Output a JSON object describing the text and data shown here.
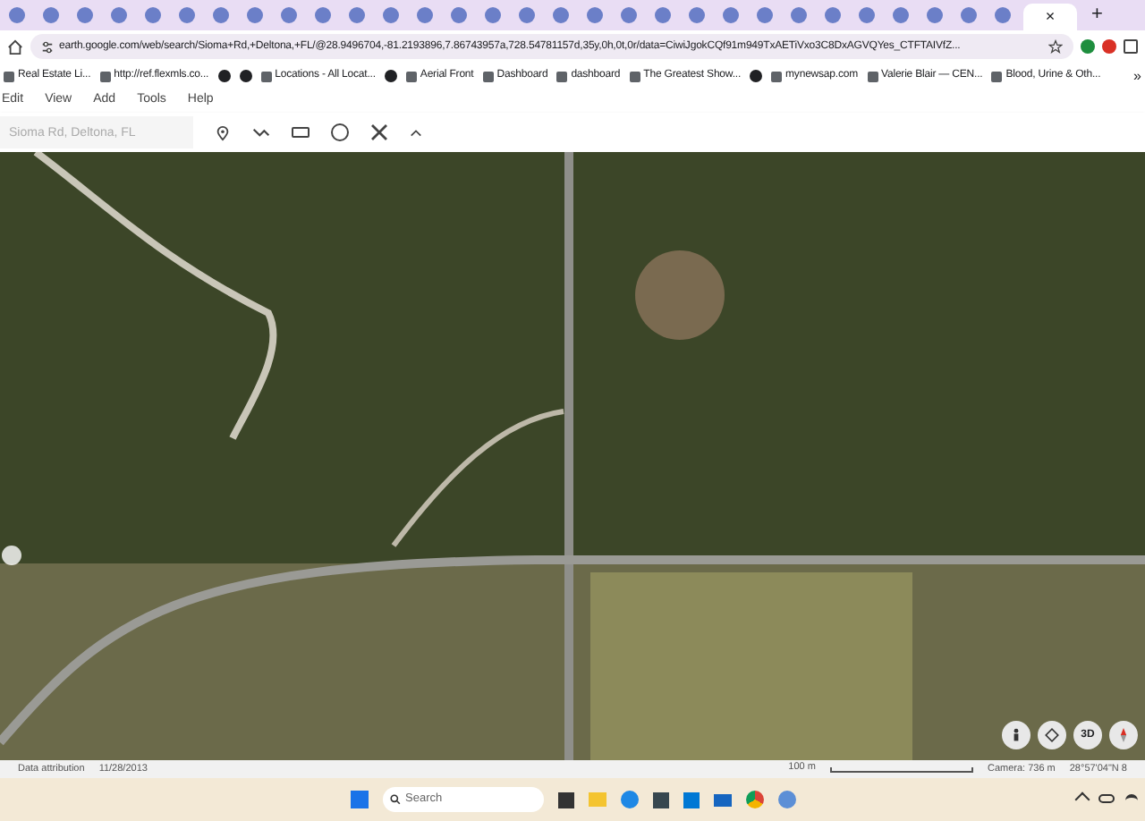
{
  "tabs": [
    {
      "selected": false
    },
    {
      "selected": false
    },
    {
      "selected": false
    },
    {
      "selected": false
    },
    {
      "selected": false
    },
    {
      "selected": false
    },
    {
      "selected": false
    },
    {
      "selected": false
    },
    {
      "selected": false
    },
    {
      "selected": false
    },
    {
      "selected": false
    },
    {
      "selected": false
    },
    {
      "selected": false
    },
    {
      "selected": false
    },
    {
      "selected": false
    },
    {
      "selected": false
    },
    {
      "selected": false
    },
    {
      "selected": false
    },
    {
      "selected": false
    },
    {
      "selected": false
    },
    {
      "selected": false
    },
    {
      "selected": false
    },
    {
      "selected": false
    },
    {
      "selected": false
    },
    {
      "selected": false
    },
    {
      "selected": false
    },
    {
      "selected": false
    },
    {
      "selected": false
    },
    {
      "selected": false
    },
    {
      "selected": false
    },
    {
      "selected": true
    }
  ],
  "tab_close": "×",
  "new_tab": "+",
  "address": "earth.google.com/web/search/Sioma+Rd,+Deltona,+FL/@28.9496704,-81.2193896,7.86743957a,728.54781157d,35y,0h,0t,0r/data=CiwiJgokCQf91m949TxAETiVxo3C8DxAGVQYes_CTFTAIVfZ...",
  "bookmarks": [
    {
      "kind": "link",
      "label": "Real Estate Li..."
    },
    {
      "kind": "link",
      "label": "http://ref.flexmls.co..."
    },
    {
      "kind": "icon"
    },
    {
      "kind": "icon"
    },
    {
      "kind": "link",
      "label": "Locations - All Locat..."
    },
    {
      "kind": "icon"
    },
    {
      "kind": "link",
      "label": "Aerial Front"
    },
    {
      "kind": "link",
      "label": "Dashboard"
    },
    {
      "kind": "link",
      "label": "dashboard"
    },
    {
      "kind": "link",
      "label": "The Greatest Show..."
    },
    {
      "kind": "icon"
    },
    {
      "kind": "link",
      "label": "mynewsap.com"
    },
    {
      "kind": "link",
      "label": "Valerie Blair — CEN..."
    },
    {
      "kind": "link",
      "label": "Blood, Urine & Oth..."
    }
  ],
  "more_bookmarks": "»",
  "menu": [
    "Edit",
    "View",
    "Add",
    "Tools",
    "Help"
  ],
  "search": {
    "placeholder": "Sioma Rd, Deltona, FL"
  },
  "map_controls": {
    "three_d": "3D"
  },
  "status_bar": {
    "attribution": "Data attribution",
    "date": "11/28/2013",
    "scale": "100 m",
    "camera": "Camera: 736 m",
    "coordinates": "28°57'04\"N 8"
  },
  "taskbar": {
    "search_placeholder": "Search"
  }
}
